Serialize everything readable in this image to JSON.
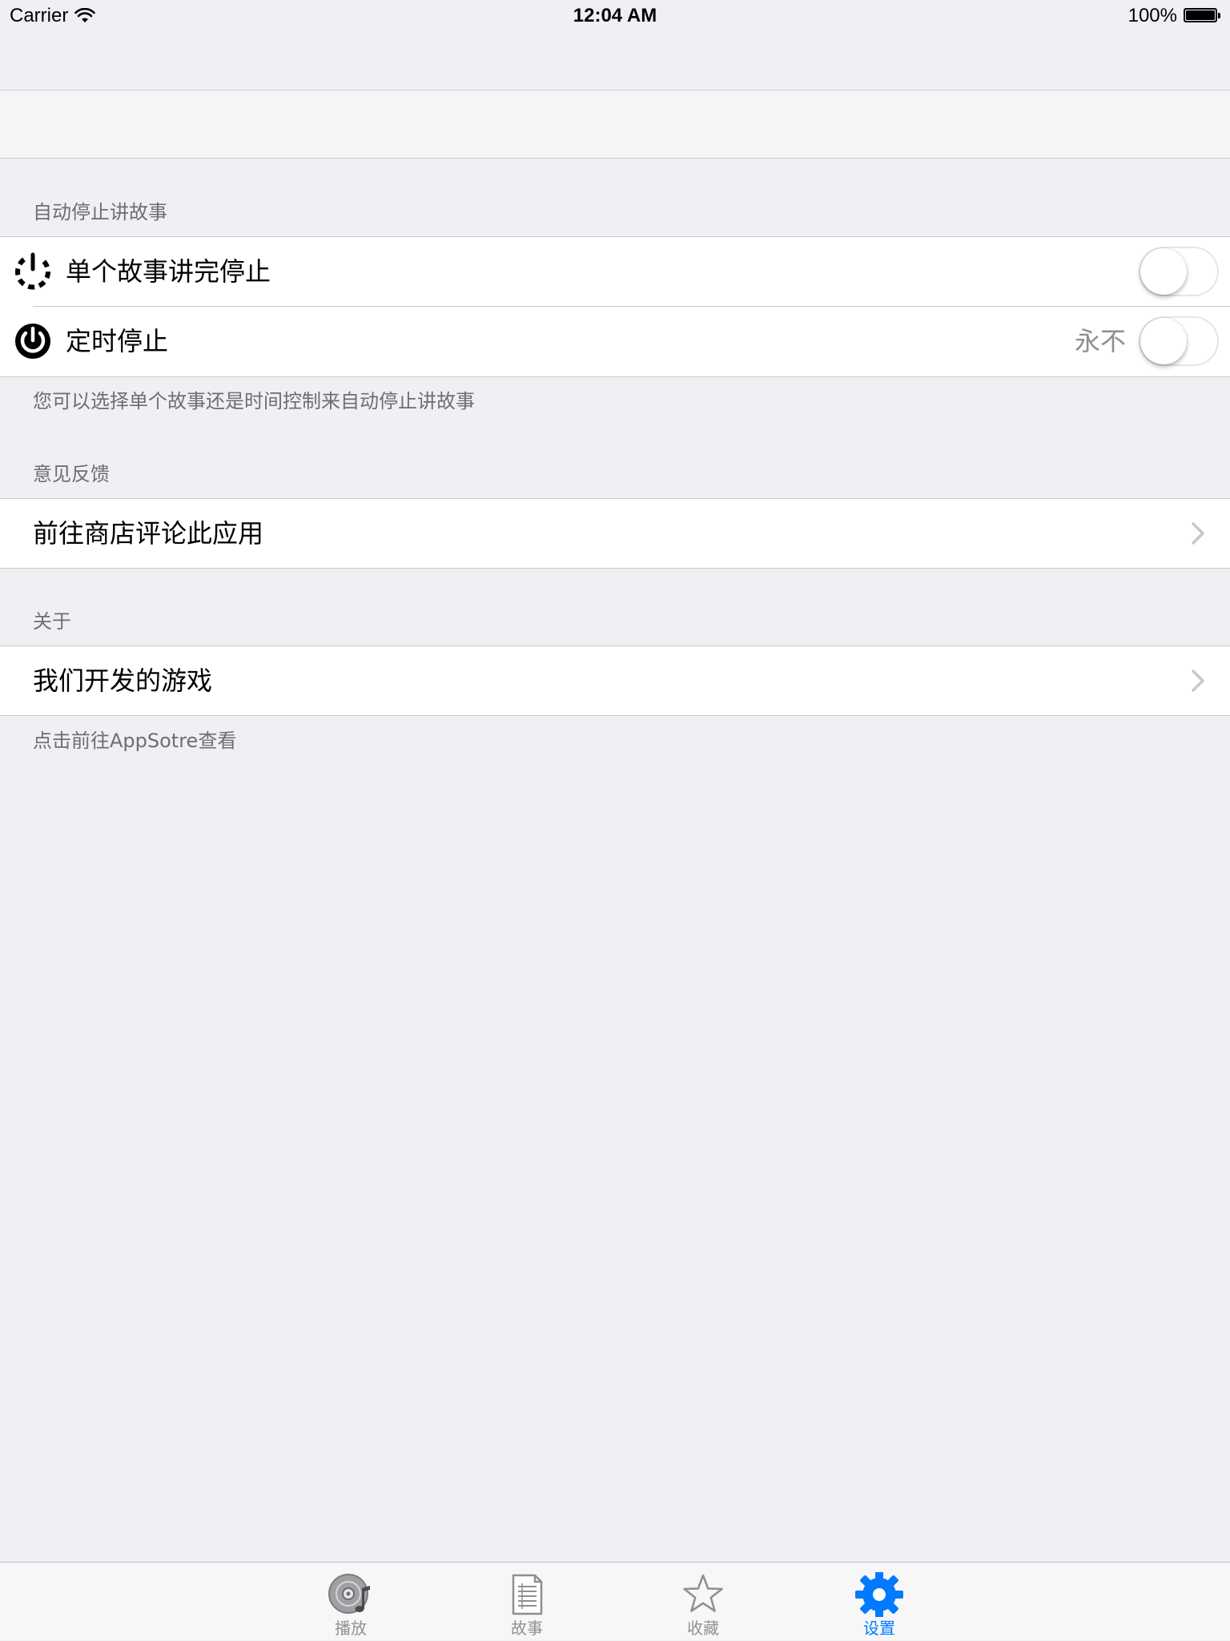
{
  "status_bar": {
    "carrier": "Carrier",
    "time": "12:04 AM",
    "battery_percent": "100%",
    "battery_level": 1.0
  },
  "sections": {
    "auto_stop": {
      "header": "自动停止讲故事",
      "single_story": {
        "label": "单个故事讲完停止",
        "icon": "dashed-power-icon",
        "switch_on": false
      },
      "timed_stop": {
        "label": "定时停止",
        "detail": "永不",
        "icon": "power-icon",
        "switch_on": false
      },
      "footer": "您可以选择单个故事还是时间控制来自动停止讲故事"
    },
    "feedback": {
      "header": "意见反馈",
      "review_label": "前往商店评论此应用"
    },
    "about": {
      "header": "关于",
      "games_label": "我们开发的游戏",
      "footer": "点击前往AppSotre查看"
    }
  },
  "tab_bar": {
    "tabs": [
      {
        "label": "播放",
        "icon": "disc-music-icon",
        "active": false
      },
      {
        "label": "故事",
        "icon": "document-icon",
        "active": false
      },
      {
        "label": "收藏",
        "icon": "star-icon",
        "active": false
      },
      {
        "label": "设置",
        "icon": "gear-icon",
        "active": true
      }
    ]
  },
  "colors": {
    "background": "#efeff4",
    "accent": "#007aff",
    "secondary_text": "#6d6d72",
    "tab_inactive": "#929292"
  }
}
